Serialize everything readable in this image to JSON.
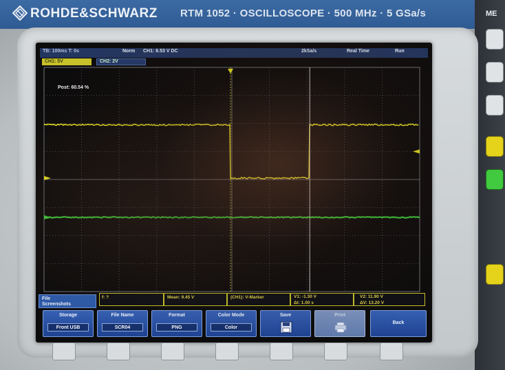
{
  "header": {
    "brand": "ROHDE&SCHWARZ",
    "model": "RTM 1052 · OSCILLOSCOPE · 500 MHz · 5 GSa/s",
    "side_label": "ME"
  },
  "status": {
    "timebase": "TB: 100ms  T: 0s",
    "trigger_mode": "Norm",
    "trigger_info": "CH1: 6.53 V DC",
    "sample_rate": "2kSa/s",
    "acq_mode": "Real Time",
    "run_state": "Run"
  },
  "channels": {
    "ch1": "CH1: 5V",
    "ch2": "CH2: 2V"
  },
  "overlay": {
    "post": "Post: 60.54 %"
  },
  "measurements": {
    "freq": "f: ?",
    "mean": "Mean: 9.45 V",
    "marker": "(CH1): V-Marker",
    "v1": "V1: -1.30 V",
    "dt": "Δt: 1.00 s",
    "v2": "V2: 11.90 V",
    "dv": "ΔV: 13.20 V"
  },
  "menu": {
    "title_line1": "File",
    "title_line2": "Screenshots",
    "softkeys": [
      {
        "label": "Storage",
        "value": "Front USB"
      },
      {
        "label": "File Name",
        "value": "SCR04"
      },
      {
        "label": "Format",
        "value": "PNG"
      },
      {
        "label": "Color Mode",
        "value": "Color"
      },
      {
        "label": "Save",
        "value": ""
      },
      {
        "label": "Print",
        "value": ""
      },
      {
        "label": "Back",
        "value": ""
      }
    ]
  },
  "colors": {
    "ch1_trace": "#e8e222",
    "ch2_trace": "#3ec83a",
    "grid": "#9aa0a8",
    "screen_bg": "#0d0c0c",
    "softkey_blue": "#2a52a3"
  },
  "icons": {
    "logo": "rohde-schwarz-diamond-icon",
    "save": "save-icon",
    "print": "printer-icon"
  },
  "waveform": {
    "description_levels_ch1": {
      "high_before": 11.9,
      "low_pulse": -1.3,
      "high_after": 11.9
    },
    "ch2_level": 0,
    "markers_divisions": {
      "v1_line": 5.0,
      "v2_line": 7.0
    }
  }
}
